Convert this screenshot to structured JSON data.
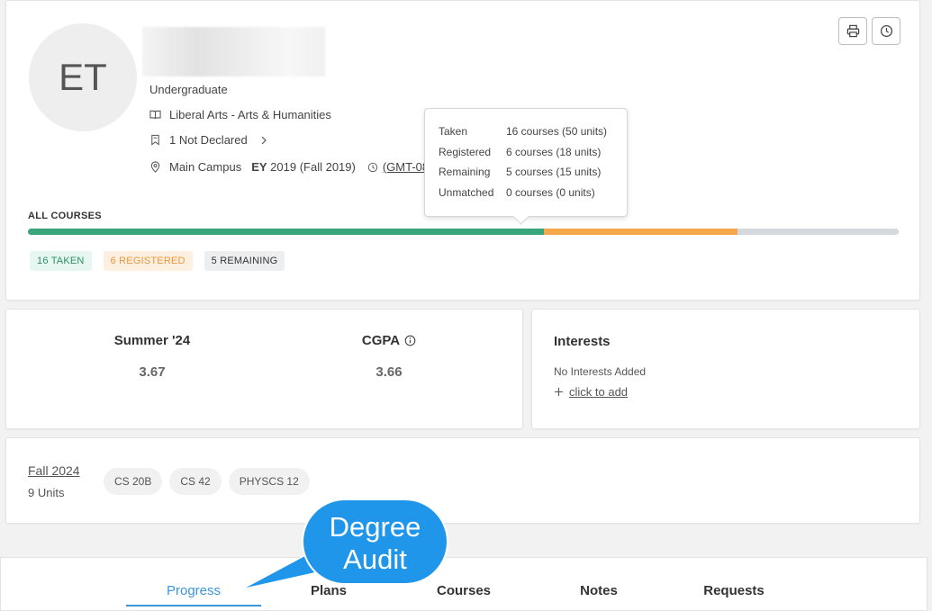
{
  "student": {
    "initials": "ET",
    "level": "Undergraduate",
    "program": "Liberal Arts - Arts & Humanities",
    "declared": "1 Not Declared",
    "campus": "Main Campus",
    "ey_label": "EY",
    "ey_value": "2019 (Fall 2019)",
    "timezone": "(GMT-08:"
  },
  "tooltip": {
    "rows": [
      {
        "label": "Taken",
        "value": "16 courses (50 units)"
      },
      {
        "label": "Registered",
        "value": "6 courses (18 units)"
      },
      {
        "label": "Remaining",
        "value": "5 courses (15 units)"
      },
      {
        "label": "Unmatched",
        "value": "0 courses (0 units)"
      }
    ]
  },
  "progress": {
    "label": "ALL COURSES",
    "taken": 16,
    "registered": 6,
    "remaining": 5,
    "badges": {
      "taken": "16 TAKEN",
      "registered": "6 REGISTERED",
      "remaining": "5 REMAINING"
    },
    "colors": {
      "taken": "#3aa57a",
      "registered": "#f5a84a",
      "remaining": "#d5d8dd"
    }
  },
  "gpa": {
    "term_label": "Summer '24",
    "term_value": "3.67",
    "cgpa_label": "CGPA",
    "cgpa_value": "3.66"
  },
  "interests": {
    "title": "Interests",
    "empty_text": "No Interests Added",
    "add_label": "click to add"
  },
  "term": {
    "name": "Fall 2024",
    "units": "9 Units",
    "courses": [
      "CS 20B",
      "CS 42",
      "PHYSCS 12"
    ]
  },
  "tabs": [
    "Progress",
    "Plans",
    "Courses",
    "Notes",
    "Requests"
  ],
  "callout": {
    "line1": "Degree",
    "line2": "Audit"
  },
  "icons": {
    "print": "printer-icon",
    "history": "clock-icon",
    "book": "book-icon",
    "bookmark": "bookmark-icon",
    "location": "location-pin-icon",
    "info": "info-icon"
  },
  "colors": {
    "accent": "#3c95d9",
    "callout": "#1f96ea"
  }
}
